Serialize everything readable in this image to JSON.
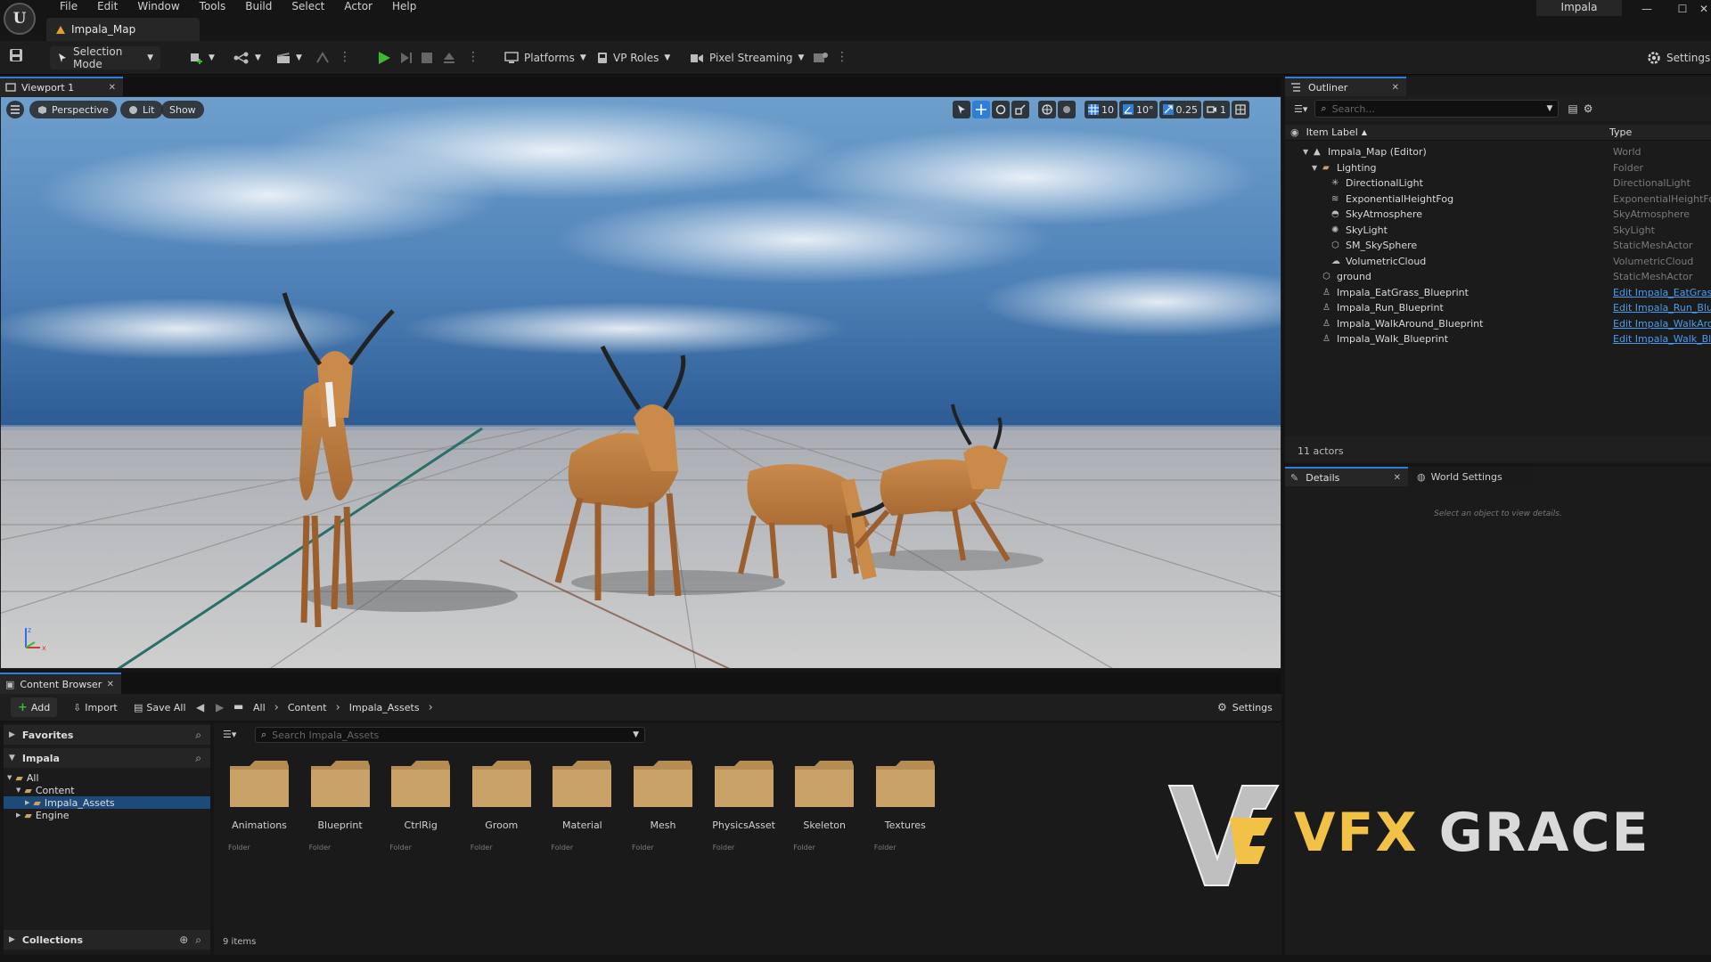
{
  "menu": [
    "File",
    "Edit",
    "Window",
    "Tools",
    "Build",
    "Select",
    "Actor",
    "Help"
  ],
  "project_name": "Impala",
  "document_tab": "Impala_Map",
  "toolbar": {
    "selection_mode": "Selection Mode",
    "platforms": "Platforms",
    "vp_roles": "VP Roles",
    "pixel_streaming": "Pixel Streaming",
    "settings": "Settings"
  },
  "viewport": {
    "tab_label": "Viewport 1",
    "perspective": "Perspective",
    "lit": "Lit",
    "show": "Show",
    "grid_snap": "10",
    "rotation_snap": "10°",
    "scale_snap": "0.25",
    "camera_speed": "1"
  },
  "outliner": {
    "tab_label": "Outliner",
    "search_placeholder": "Search...",
    "col_label": "Item Label",
    "col_type": "Type",
    "rows": [
      {
        "label": "Impala_Map (Editor)",
        "type": "World",
        "indent": 0,
        "icon": "map-icon",
        "link": false
      },
      {
        "label": "Lighting",
        "type": "Folder",
        "indent": 1,
        "icon": "folder-icon",
        "link": false
      },
      {
        "label": "DirectionalLight",
        "type": "DirectionalLight",
        "indent": 2,
        "icon": "sun-icon",
        "link": false
      },
      {
        "label": "ExponentialHeightFog",
        "type": "ExponentialHeightFog",
        "indent": 2,
        "icon": "fog-icon",
        "link": false
      },
      {
        "label": "SkyAtmosphere",
        "type": "SkyAtmosphere",
        "indent": 2,
        "icon": "atmosphere-icon",
        "link": false
      },
      {
        "label": "SkyLight",
        "type": "SkyLight",
        "indent": 2,
        "icon": "skylight-icon",
        "link": false
      },
      {
        "label": "SM_SkySphere",
        "type": "StaticMeshActor",
        "indent": 2,
        "icon": "mesh-icon",
        "link": false
      },
      {
        "label": "VolumetricCloud",
        "type": "VolumetricCloud",
        "indent": 2,
        "icon": "cloud-icon",
        "link": false
      },
      {
        "label": "ground",
        "type": "StaticMeshActor",
        "indent": 1,
        "icon": "mesh-icon",
        "link": false
      },
      {
        "label": "Impala_EatGrass_Blueprint",
        "type": "Edit Impala_EatGrass_",
        "indent": 1,
        "icon": "pawn-icon",
        "link": true
      },
      {
        "label": "Impala_Run_Blueprint",
        "type": "Edit Impala_Run_Bluep",
        "indent": 1,
        "icon": "pawn-icon",
        "link": true
      },
      {
        "label": "Impala_WalkAround_Blueprint",
        "type": "Edit Impala_WalkArou",
        "indent": 1,
        "icon": "pawn-icon",
        "link": true
      },
      {
        "label": "Impala_Walk_Blueprint",
        "type": "Edit Impala_Walk_Blue",
        "indent": 1,
        "icon": "pawn-icon",
        "link": true
      }
    ],
    "actor_count": "11 actors"
  },
  "details": {
    "tab_label": "Details",
    "world_settings_label": "World Settings",
    "empty_message": "Select an object to view details."
  },
  "content_browser": {
    "tab_label": "Content Browser",
    "add": "Add",
    "import": "Import",
    "save_all": "Save All",
    "breadcrumb": [
      "All",
      "Content",
      "Impala_Assets"
    ],
    "settings": "Settings",
    "favorites": "Favorites",
    "impala": "Impala",
    "tree": [
      {
        "label": "All",
        "indent": 0,
        "selected": false
      },
      {
        "label": "Content",
        "indent": 1,
        "selected": false
      },
      {
        "label": "Impala_Assets",
        "indent": 2,
        "selected": true
      },
      {
        "label": "Engine",
        "indent": 1,
        "selected": false
      }
    ],
    "collections": "Collections",
    "search_placeholder": "Search Impala_Assets",
    "folders": [
      "Animations",
      "Blueprint",
      "CtrlRig",
      "Groom",
      "Material",
      "Mesh",
      "PhysicsAsset",
      "Skeleton",
      "Textures"
    ],
    "folder_type": "Folder",
    "item_count": "9 items"
  },
  "watermark": {
    "text_a": "VFX",
    "text_b": "GRACE"
  },
  "colors": {
    "accent": "#2f7fd8",
    "play": "#3cb832",
    "folder": "#c9a26a",
    "link": "#4a9cf0"
  }
}
